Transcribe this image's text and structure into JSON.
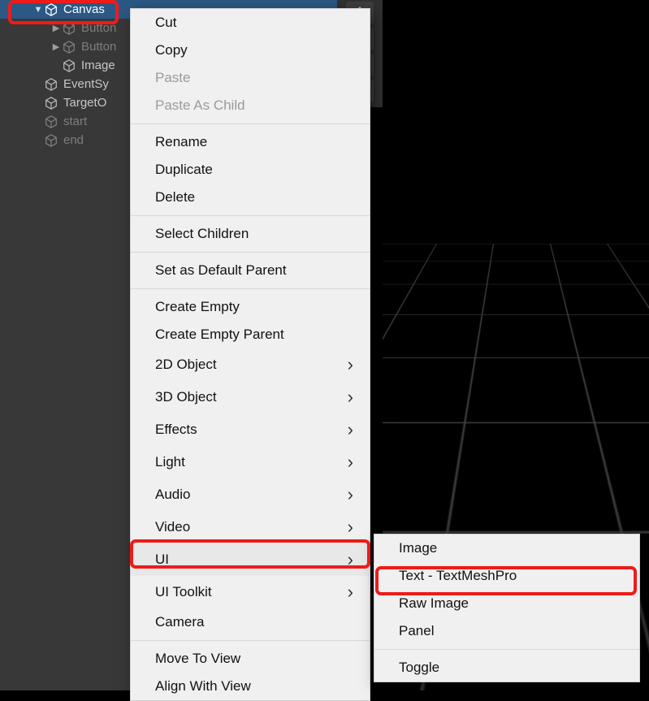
{
  "hierarchy": {
    "items": [
      {
        "label": "Canvas"
      },
      {
        "label": "Button"
      },
      {
        "label": "Button"
      },
      {
        "label": "Image"
      },
      {
        "label": "EventSy"
      },
      {
        "label": "TargetO"
      },
      {
        "label": "start"
      },
      {
        "label": "end"
      }
    ]
  },
  "context_menu": {
    "cut": "Cut",
    "copy": "Copy",
    "paste": "Paste",
    "paste_as_child": "Paste As Child",
    "rename": "Rename",
    "duplicate": "Duplicate",
    "delete": "Delete",
    "select_children": "Select Children",
    "set_as_default_parent": "Set as Default Parent",
    "create_empty": "Create Empty",
    "create_empty_parent": "Create Empty Parent",
    "obj2d": "2D Object",
    "obj3d": "3D Object",
    "effects": "Effects",
    "light": "Light",
    "audio": "Audio",
    "video": "Video",
    "ui": "UI",
    "ui_toolkit": "UI Toolkit",
    "camera": "Camera",
    "move_to_view": "Move To View",
    "align_with_view": "Align With View"
  },
  "ui_submenu": {
    "image": "Image",
    "text_tmp": "Text - TextMeshPro",
    "raw_image": "Raw Image",
    "panel": "Panel",
    "toggle": "Toggle"
  }
}
